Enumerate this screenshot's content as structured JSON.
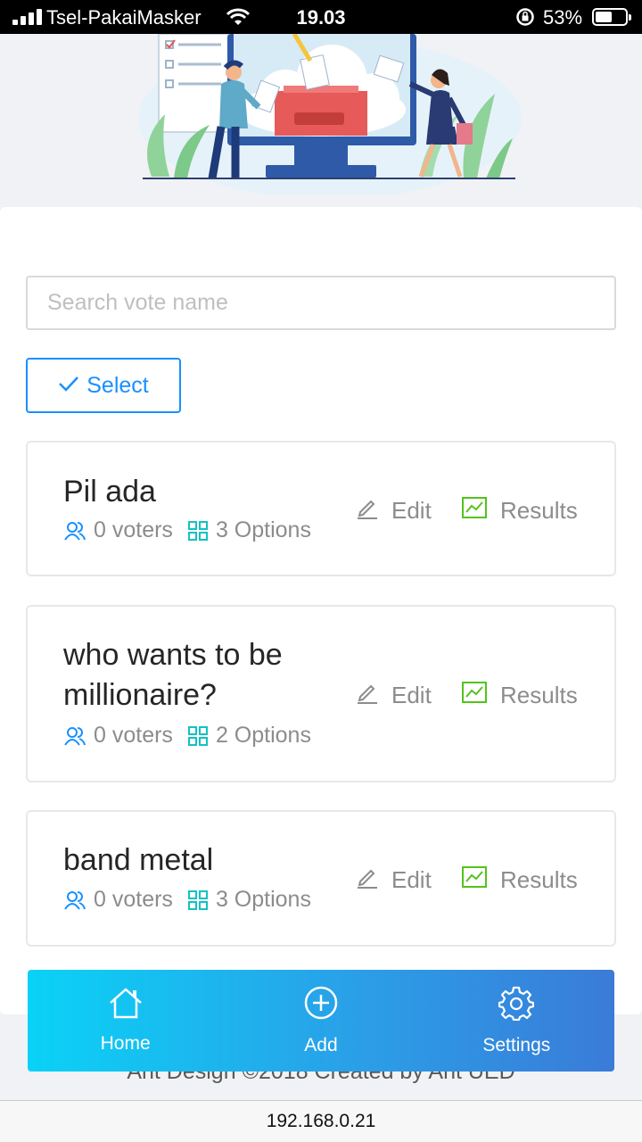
{
  "status_bar": {
    "carrier": "Tsel-PakaiMasker",
    "time": "19.03",
    "battery": "53%"
  },
  "search": {
    "placeholder": "Search vote name"
  },
  "select_button": {
    "label": "Select"
  },
  "votes": [
    {
      "title": "Pil ada",
      "voters": "0 voters",
      "options": "3 Options",
      "edit_label": "Edit",
      "results_label": "Results"
    },
    {
      "title": "who wants to be millionaire?",
      "voters": "0 voters",
      "options": "2 Options",
      "edit_label": "Edit",
      "results_label": "Results"
    },
    {
      "title": "band metal",
      "voters": "0 voters",
      "options": "3 Options",
      "edit_label": "Edit",
      "results_label": "Results"
    }
  ],
  "footer": {
    "text": "Ant Design ©2018 Created by Ant UED"
  },
  "tabbar": {
    "home": "Home",
    "add": "Add",
    "settings": "Settings"
  },
  "url_bar": {
    "url": "192.168.0.21"
  },
  "colors": {
    "primary": "#1890ff",
    "voters_icon": "#1890ff",
    "options_icon": "#13c2c2",
    "results_icon": "#52c41a",
    "tabbar_start": "#0ad2f6",
    "tabbar_end": "#3a7bd8"
  }
}
